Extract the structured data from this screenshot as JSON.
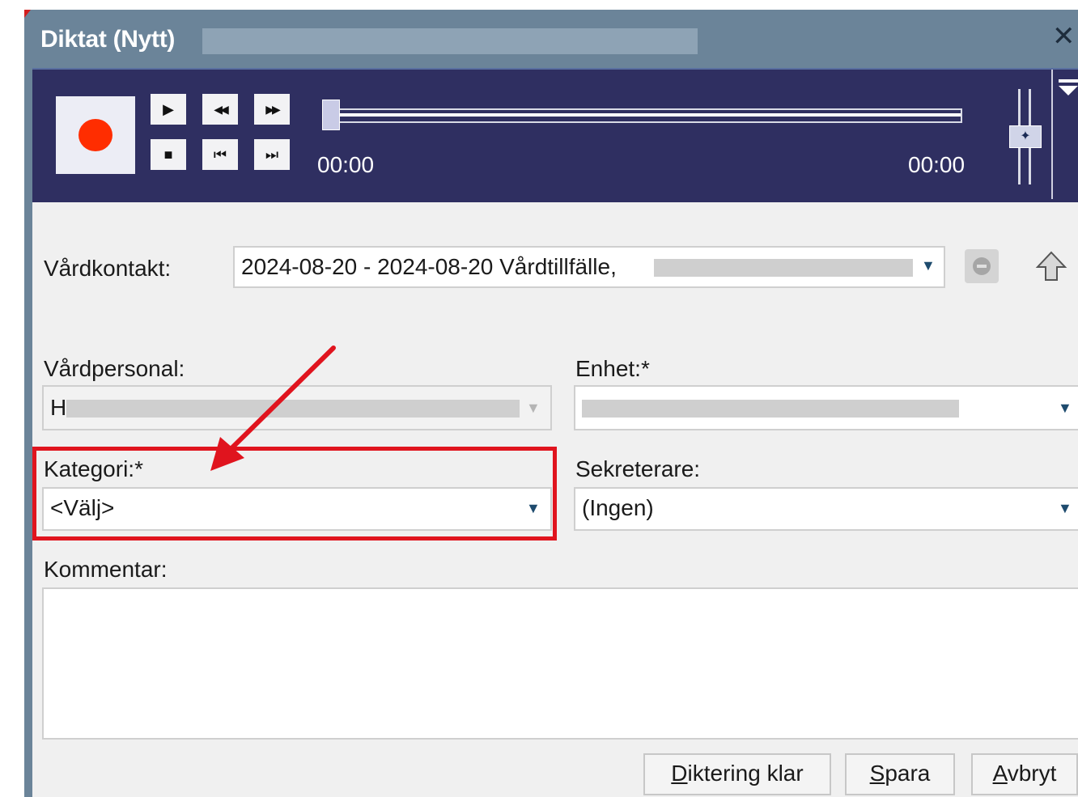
{
  "window": {
    "title": "Diktat (Nytt)",
    "close_glyph": "✕"
  },
  "player": {
    "time_elapsed": "00:00",
    "time_total": "00:00",
    "progress": 0,
    "controls": [
      {
        "name": "play-icon",
        "glyph": "▶"
      },
      {
        "name": "rewind-icon",
        "glyph": "◀◀"
      },
      {
        "name": "fast-forward-icon",
        "glyph": "▶▶"
      },
      {
        "name": "stop-icon",
        "glyph": "■"
      },
      {
        "name": "skip-to-start-icon",
        "glyph": "⏮"
      },
      {
        "name": "skip-to-end-icon",
        "glyph": "⏭"
      }
    ]
  },
  "form": {
    "vardkontakt": {
      "label": "Vårdkontakt:",
      "value": "2024-08-20 - 2024-08-20 Vårdtillfälle,"
    },
    "vardpersonal": {
      "label": "Vårdpersonal:",
      "value": "H"
    },
    "enhet": {
      "label": "Enhet:*"
    },
    "kategori": {
      "label": "Kategori:*",
      "value": "<Välj>"
    },
    "sekreterare": {
      "label": "Sekreterare:",
      "value": "(Ingen)"
    },
    "kommentar": {
      "label": "Kommentar:"
    }
  },
  "buttons": {
    "diktering_klar": {
      "accel": "D",
      "rest": "iktering klar"
    },
    "spara": {
      "accel": "S",
      "rest": "para"
    },
    "avbryt": {
      "accel": "A",
      "rest": "vbryt"
    }
  },
  "colors": {
    "titlebar": "#6b8499",
    "player_bg": "#2f2f61",
    "record_red": "#ff2d00",
    "highlight": "#e0141e",
    "dropdown_arrow": "#1e4b6e"
  }
}
